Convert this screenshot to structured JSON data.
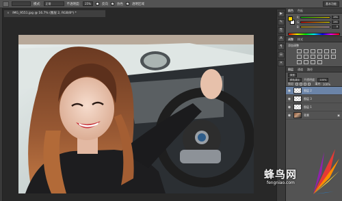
{
  "options_bar": {
    "mode_label": "模式:",
    "mode_value": "正常",
    "opacity_label": "不透明度:",
    "opacity_value": "25%",
    "reverse_label": "反向",
    "dither_label": "仿色",
    "transparency_label": "透明区域",
    "workspace_value": "基本功能"
  },
  "document": {
    "tab_title": "IMG_9551.jpg @ 16.7% (图层 2, RGB/8*) *",
    "close_glyph": "×"
  },
  "dock": {
    "icons": [
      "play-icon",
      "brush-icon",
      "clone-icon",
      "text-icon",
      "character-icon",
      "paragraph-icon",
      "tools-icon"
    ],
    "glyphs": [
      "▶",
      "✎",
      "⎘",
      "A",
      "¶",
      "☰",
      "✕"
    ]
  },
  "color_panel": {
    "tabs": [
      "颜色",
      "色板"
    ],
    "fg_color": "#ffd400",
    "bg_color": "#ffffff",
    "channels": [
      {
        "name": "R",
        "value": "251",
        "gradient": "linear-gradient(to right,#00d400,#ffd400)"
      },
      {
        "name": "G",
        "value": "241",
        "gradient": "linear-gradient(to right,#ff0000,#ffff00)"
      },
      {
        "name": "B",
        "value": "0",
        "gradient": "linear-gradient(to right,#ffd400,#ffd4ff)"
      }
    ]
  },
  "adjustments_panel": {
    "tabs": [
      "调整",
      "样式"
    ],
    "title": "添加调整"
  },
  "layers_panel": {
    "tabs": [
      "图层",
      "通道",
      "路径"
    ],
    "kind_label": "类型",
    "blend_mode": "颜色减淡",
    "opacity_label": "不透明度:",
    "opacity_value": "100%",
    "lock_label": "锁定:",
    "fill_label": "填充:",
    "fill_value": "100%",
    "layers": [
      {
        "name": "图层 2",
        "selected": true,
        "kind": "empty"
      },
      {
        "name": "图层 3",
        "selected": false,
        "kind": "empty"
      },
      {
        "name": "图层 1",
        "selected": false,
        "kind": "empty"
      },
      {
        "name": "背景",
        "selected": false,
        "kind": "photo"
      }
    ],
    "lock_glyph": "🔒"
  },
  "watermark": {
    "brand": "蜂鸟网",
    "url": "fengniao.com"
  }
}
